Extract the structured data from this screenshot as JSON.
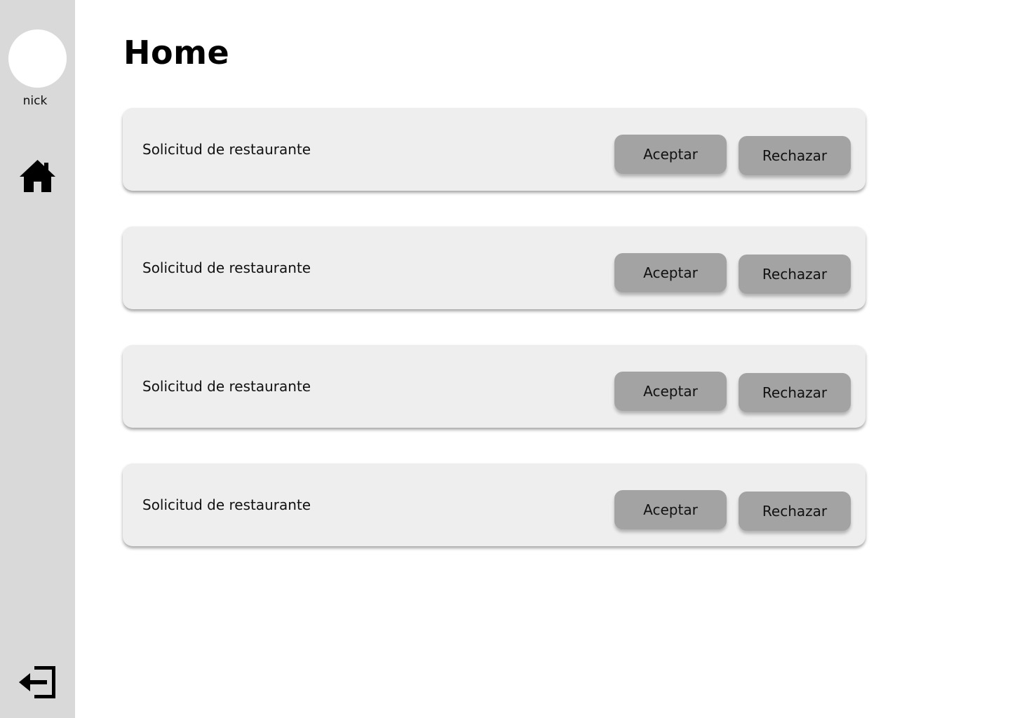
{
  "sidebar": {
    "username": "nick",
    "home_icon": "home-icon",
    "logout_icon": "logout-icon"
  },
  "main": {
    "title": "Home",
    "requests": [
      {
        "label": "Solicitud de restaurante",
        "accept_label": "Aceptar",
        "reject_label": "Rechazar"
      },
      {
        "label": "Solicitud de restaurante",
        "accept_label": "Aceptar",
        "reject_label": "Rechazar"
      },
      {
        "label": "Solicitud de restaurante",
        "accept_label": "Aceptar",
        "reject_label": "Rechazar"
      },
      {
        "label": "Solicitud de restaurante",
        "accept_label": "Aceptar",
        "reject_label": "Rechazar"
      }
    ]
  },
  "colors": {
    "sidebar_bg": "#d9d9d9",
    "card_bg": "#eeeeee",
    "button_bg": "#a3a3a3"
  }
}
